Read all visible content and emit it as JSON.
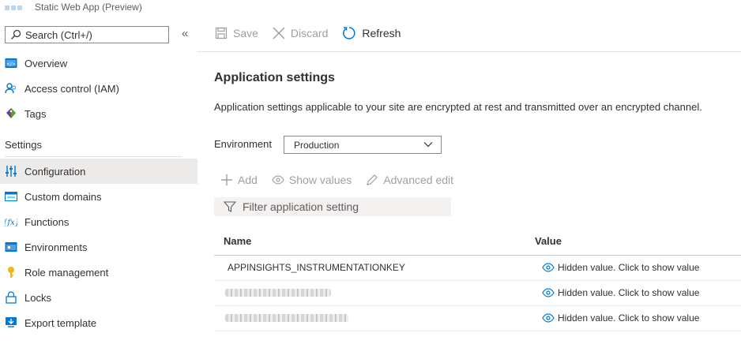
{
  "app": {
    "subtitle": "Static Web App (Preview)"
  },
  "sidebar": {
    "search_placeholder": "Search (Ctrl+/)",
    "collapse": "«",
    "top_items": [
      {
        "label": "Overview",
        "icon": "overview-icon"
      },
      {
        "label": "Access control (IAM)",
        "icon": "people-icon"
      },
      {
        "label": "Tags",
        "icon": "tag-icon"
      }
    ],
    "settings_heading": "Settings",
    "settings_items": [
      {
        "label": "Configuration",
        "icon": "sliders-icon",
        "selected": true
      },
      {
        "label": "Custom domains",
        "icon": "domain-icon"
      },
      {
        "label": "Functions",
        "icon": "function-icon"
      },
      {
        "label": "Environments",
        "icon": "environments-icon"
      },
      {
        "label": "Role management",
        "icon": "key-icon"
      },
      {
        "label": "Locks",
        "icon": "lock-icon"
      },
      {
        "label": "Export template",
        "icon": "export-icon"
      }
    ]
  },
  "toolbar": {
    "save": "Save",
    "discard": "Discard",
    "refresh": "Refresh"
  },
  "main": {
    "title": "Application settings",
    "description": "Application settings applicable to your site are encrypted at rest and transmitted over an encrypted channel.",
    "environment_label": "Environment",
    "environment_value": "Production",
    "actions": {
      "add": "Add",
      "show_values": "Show values",
      "advanced_edit": "Advanced edit"
    },
    "filter_placeholder": "Filter application setting",
    "table": {
      "headers": {
        "name": "Name",
        "value": "Value"
      },
      "rows": [
        {
          "name": "APPINSIGHTS_INSTRUMENTATIONKEY",
          "value": "Hidden value. Click to show value"
        },
        {
          "name": "",
          "value": "Hidden value. Click to show value"
        },
        {
          "name": "",
          "value": "Hidden value. Click to show value"
        }
      ]
    }
  },
  "colors": {
    "accent": "#0078d4",
    "disabled": "#a19f9d",
    "selected_bg": "#edebe9"
  }
}
